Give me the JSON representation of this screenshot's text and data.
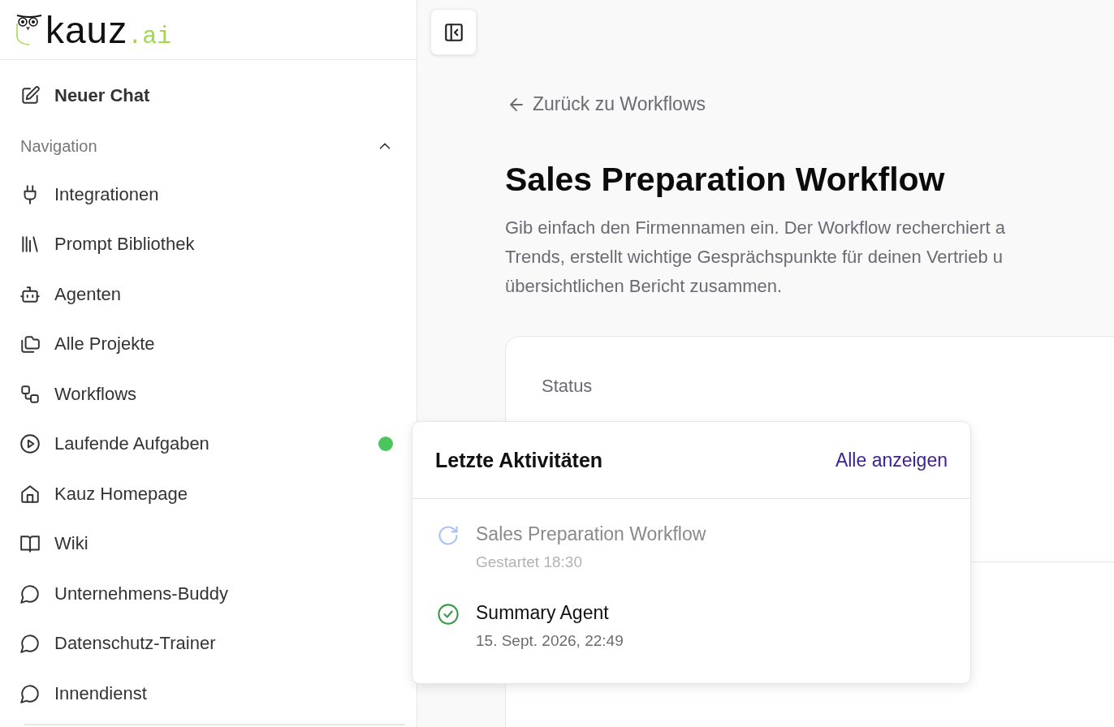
{
  "logo": {
    "name": "kauz",
    "suffix": ".ai"
  },
  "sidebar": {
    "new_chat": "Neuer Chat",
    "section": {
      "label": "Navigation",
      "expanded": true
    },
    "items": [
      {
        "label": "Integrationen",
        "indicator": false
      },
      {
        "label": "Prompt Bibliothek",
        "indicator": false
      },
      {
        "label": "Agenten",
        "indicator": false
      },
      {
        "label": "Alle Projekte",
        "indicator": false
      },
      {
        "label": "Workflows",
        "indicator": false
      },
      {
        "label": "Laufende Aufgaben",
        "indicator": true
      },
      {
        "label": "Kauz Homepage",
        "indicator": false
      },
      {
        "label": "Wiki",
        "indicator": false
      },
      {
        "label": "Unternehmens-Buddy",
        "indicator": false
      },
      {
        "label": "Datenschutz-Trainer",
        "indicator": false
      },
      {
        "label": "Innendienst",
        "indicator": false
      }
    ]
  },
  "main": {
    "back_link": "Zurück zu Workflows",
    "title": "Sales Preparation Workflow",
    "description": [
      "Gib einfach den Firmennamen ein. Der Workflow recherchiert a",
      "Trends, erstellt wichtige Gesprächspunkte für deinen Vertrieb u",
      "übersichtlichen Bericht zusammen."
    ],
    "card": {
      "label": "Status"
    }
  },
  "activity_popup": {
    "title": "Letzte Aktivitäten",
    "link": "Alle anzeigen",
    "items": [
      {
        "kind": "running",
        "title": "Sales Preparation Workflow",
        "subtitle": "Gestartet 18:30"
      },
      {
        "kind": "done",
        "title": "Summary Agent",
        "subtitle": "15. Sept. 2026, 22:49"
      }
    ]
  }
}
